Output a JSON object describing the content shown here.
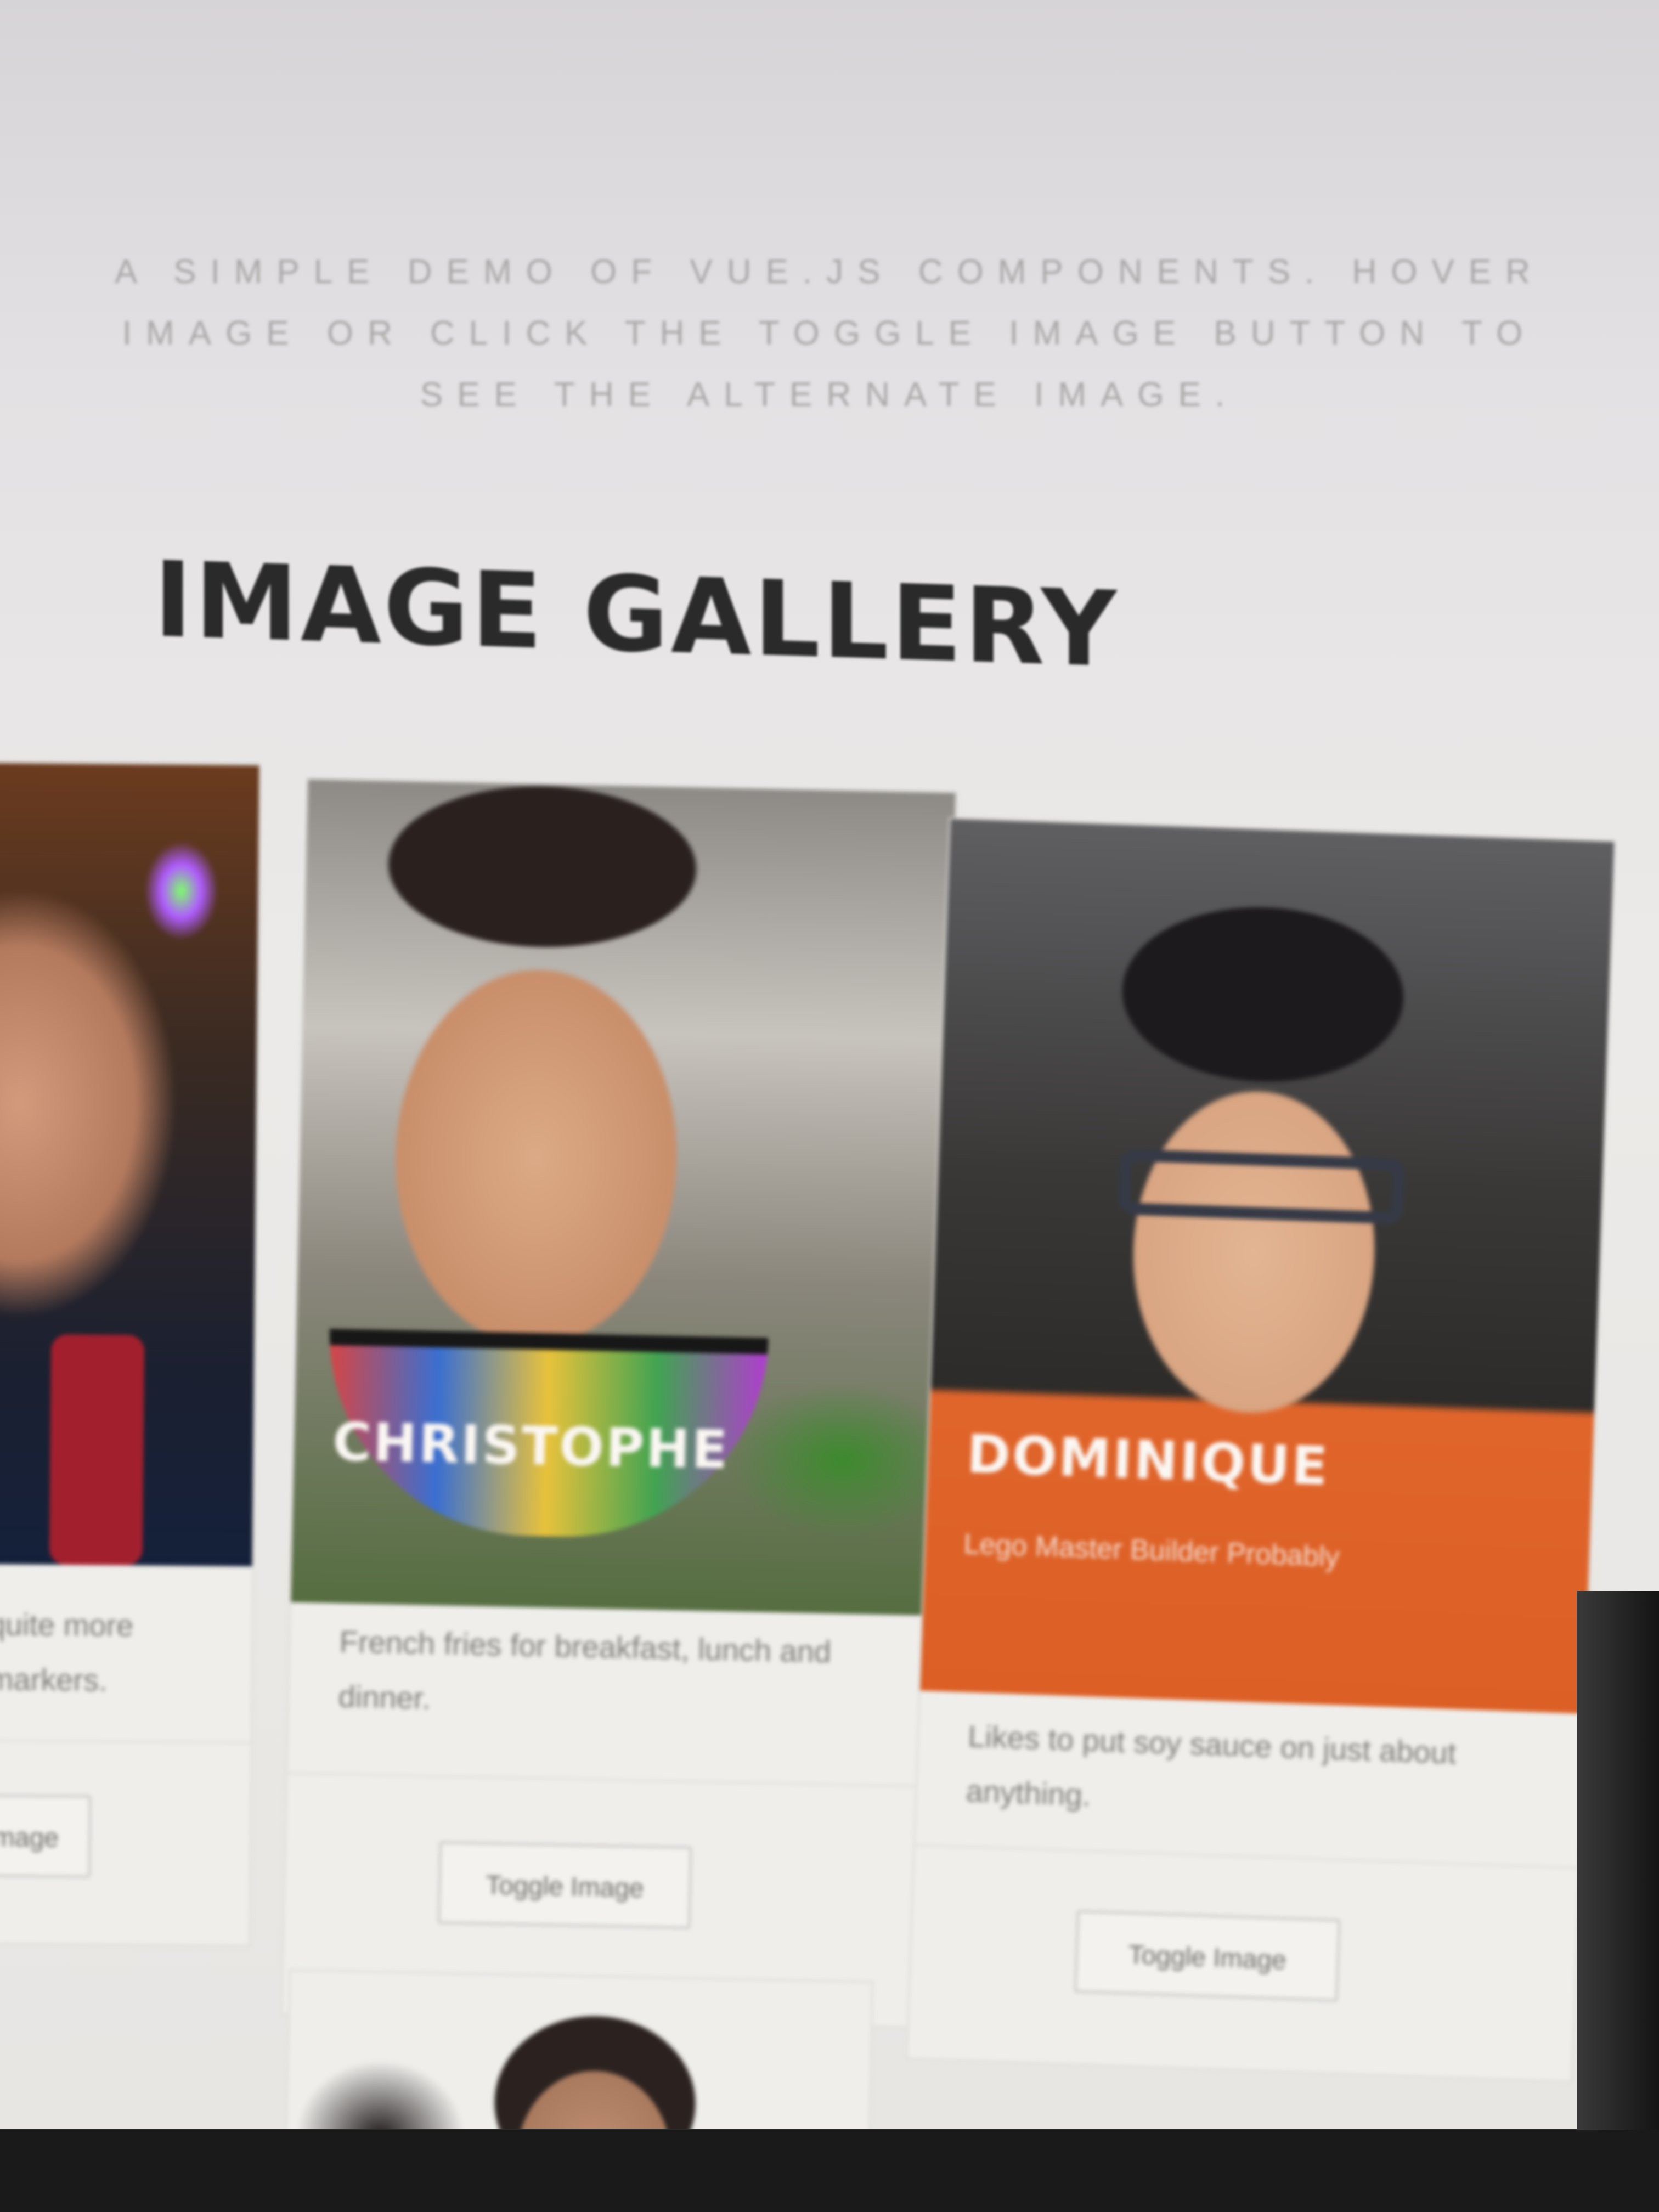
{
  "intro": {
    "line1": "A SIMPLE DEMO OF VUE.JS COMPONENTS. HOVER",
    "line2": "IMAGE OR CLICK THE TOGGLE IMAGE BUTTON TO",
    "line3": "SEE THE ALTERNATE IMAGE."
  },
  "gallery": {
    "title": "IMAGE GALLERY",
    "cards": [
      {
        "name": "",
        "tagline": "",
        "description": "quite more markers.",
        "toggle_label": "Image"
      },
      {
        "name": "CHRISTOPHE",
        "tagline": "",
        "description": "French fries for breakfast, lunch and dinner.",
        "toggle_label": "Toggle Image"
      },
      {
        "name": "DOMINIQUE",
        "tagline": "Lego Master Builder Probably",
        "description": "Likes to put soy sauce on just about anything.",
        "toggle_label": "Toggle Image"
      }
    ]
  },
  "colors": {
    "page_bg": "#e7e6e3",
    "title": "#2a2a2a",
    "card_bg": "#efeeeb",
    "orange_shirt": "#dc5f25"
  }
}
